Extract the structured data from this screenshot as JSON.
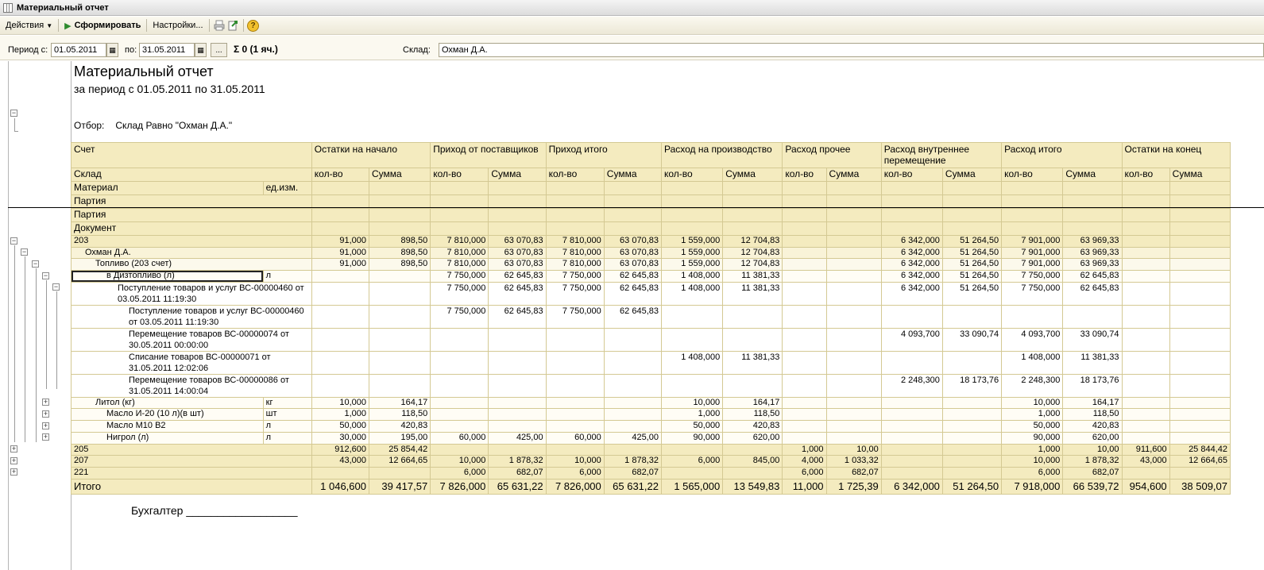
{
  "window": {
    "title": "Материальный отчет"
  },
  "toolbar": {
    "actions": "Действия",
    "generate": "Сформировать",
    "settings": "Настройки...",
    "help": "?"
  },
  "filter": {
    "period_from_label": "Период с:",
    "period_from": "01.05.2011",
    "period_to_label": "по:",
    "period_to": "31.05.2011",
    "dots": "...",
    "sigma": "Σ 0 (1 яч.)",
    "warehouse_label": "Склад:",
    "warehouse": "Охман Д.А."
  },
  "report": {
    "title": "Материальный отчет",
    "subtitle": "за период с 01.05.2011 по 31.05.2011",
    "filter_label": "Отбор:",
    "filter_value": "Склад Равно \"Охман Д.А.\"",
    "signature": "Бухгалтер __________________",
    "headers": {
      "account": "Счет",
      "warehouse": "Склад",
      "material": "Материал",
      "unit": "ед.изм.",
      "batch1": "Партия",
      "batch2": "Партия",
      "document": "Документ",
      "groups": [
        "Остатки на начало",
        "Приход от поставщиков",
        "Приход итого",
        "Расход на производство",
        "Расход прочее",
        "Расход внутреннее перемещение",
        "Расход итого",
        "Остатки на конец"
      ],
      "qty": "кол-во",
      "sum": "Сумма"
    },
    "rows": [
      {
        "label": "203",
        "unit": "",
        "v": [
          "91,000",
          "898,50",
          "7 810,000",
          "63 070,83",
          "7 810,000",
          "63 070,83",
          "1 559,000",
          "12 704,83",
          "",
          "",
          "6 342,000",
          "51 264,50",
          "7 901,000",
          "63 969,33",
          "",
          ""
        ]
      },
      {
        "label": "Охман Д.А.",
        "unit": "",
        "v": [
          "91,000",
          "898,50",
          "7 810,000",
          "63 070,83",
          "7 810,000",
          "63 070,83",
          "1 559,000",
          "12 704,83",
          "",
          "",
          "6 342,000",
          "51 264,50",
          "7 901,000",
          "63 969,33",
          "",
          ""
        ]
      },
      {
        "label": "Топливо (203 счет)",
        "unit": "",
        "v": [
          "91,000",
          "898,50",
          "7 810,000",
          "63 070,83",
          "7 810,000",
          "63 070,83",
          "1 559,000",
          "12 704,83",
          "",
          "",
          "6 342,000",
          "51 264,50",
          "7 901,000",
          "63 969,33",
          "",
          ""
        ]
      },
      {
        "label": "в Дизтопливо (л)",
        "unit": "л",
        "v": [
          "",
          "",
          "7 750,000",
          "62 645,83",
          "7 750,000",
          "62 645,83",
          "1 408,000",
          "11 381,33",
          "",
          "",
          "6 342,000",
          "51 264,50",
          "7 750,000",
          "62 645,83",
          "",
          ""
        ]
      },
      {
        "label": "Поступление товаров и услуг ВС-00000460 от 03.05.2011 11:19:30",
        "unit": "",
        "v": [
          "",
          "",
          "7 750,000",
          "62 645,83",
          "7 750,000",
          "62 645,83",
          "1 408,000",
          "11 381,33",
          "",
          "",
          "6 342,000",
          "51 264,50",
          "7 750,000",
          "62 645,83",
          "",
          ""
        ]
      },
      {
        "label": "Поступление товаров и услуг ВС-00000460 от 03.05.2011 11:19:30",
        "unit": "",
        "v": [
          "",
          "",
          "7 750,000",
          "62 645,83",
          "7 750,000",
          "62 645,83",
          "",
          "",
          "",
          "",
          "",
          "",
          "",
          "",
          "",
          ""
        ]
      },
      {
        "label": "Перемещение товаров ВС-00000074 от 30.05.2011 00:00:00",
        "unit": "",
        "v": [
          "",
          "",
          "",
          "",
          "",
          "",
          "",
          "",
          "",
          "",
          "4 093,700",
          "33 090,74",
          "4 093,700",
          "33 090,74",
          "",
          ""
        ]
      },
      {
        "label": "Списание товаров ВС-00000071 от 31.05.2011 12:02:06",
        "unit": "",
        "v": [
          "",
          "",
          "",
          "",
          "",
          "",
          "1 408,000",
          "11 381,33",
          "",
          "",
          "",
          "",
          "1 408,000",
          "11 381,33",
          "",
          ""
        ]
      },
      {
        "label": "Перемещение товаров ВС-00000086 от 31.05.2011 14:00:04",
        "unit": "",
        "v": [
          "",
          "",
          "",
          "",
          "",
          "",
          "",
          "",
          "",
          "",
          "2 248,300",
          "18 173,76",
          "2 248,300",
          "18 173,76",
          "",
          ""
        ]
      },
      {
        "label": "Литол  (кг)",
        "unit": "кг",
        "v": [
          "10,000",
          "164,17",
          "",
          "",
          "",
          "",
          "10,000",
          "164,17",
          "",
          "",
          "",
          "",
          "10,000",
          "164,17",
          "",
          ""
        ]
      },
      {
        "label": "Масло И-20 (10 л)(в шт)",
        "unit": "шт",
        "v": [
          "1,000",
          "118,50",
          "",
          "",
          "",
          "",
          "1,000",
          "118,50",
          "",
          "",
          "",
          "",
          "1,000",
          "118,50",
          "",
          ""
        ]
      },
      {
        "label": "Масло М10  В2",
        "unit": "л",
        "v": [
          "50,000",
          "420,83",
          "",
          "",
          "",
          "",
          "50,000",
          "420,83",
          "",
          "",
          "",
          "",
          "50,000",
          "420,83",
          "",
          ""
        ]
      },
      {
        "label": "Нигрол (л)",
        "unit": "л",
        "v": [
          "30,000",
          "195,00",
          "60,000",
          "425,00",
          "60,000",
          "425,00",
          "90,000",
          "620,00",
          "",
          "",
          "",
          "",
          "90,000",
          "620,00",
          "",
          ""
        ]
      },
      {
        "label": "205",
        "unit": "",
        "v": [
          "912,600",
          "25 854,42",
          "",
          "",
          "",
          "",
          "",
          "",
          "1,000",
          "10,00",
          "",
          "",
          "1,000",
          "10,00",
          "911,600",
          "25 844,42"
        ]
      },
      {
        "label": "207",
        "unit": "",
        "v": [
          "43,000",
          "12 664,65",
          "10,000",
          "1 878,32",
          "10,000",
          "1 878,32",
          "6,000",
          "845,00",
          "4,000",
          "1 033,32",
          "",
          "",
          "10,000",
          "1 878,32",
          "43,000",
          "12 664,65"
        ]
      },
      {
        "label": "221",
        "unit": "",
        "v": [
          "",
          "",
          "6,000",
          "682,07",
          "6,000",
          "682,07",
          "",
          "",
          "6,000",
          "682,07",
          "",
          "",
          "6,000",
          "682,07",
          "",
          ""
        ]
      },
      {
        "label": "Итого",
        "unit": "",
        "v": [
          "1 046,600",
          "39 417,57",
          "7 826,000",
          "65 631,22",
          "7 826,000",
          "65 631,22",
          "1 565,000",
          "13 549,83",
          "11,000",
          "1 725,39",
          "6 342,000",
          "51 264,50",
          "7 918,000",
          "66 539,72",
          "954,600",
          "38 509,07"
        ]
      }
    ]
  }
}
